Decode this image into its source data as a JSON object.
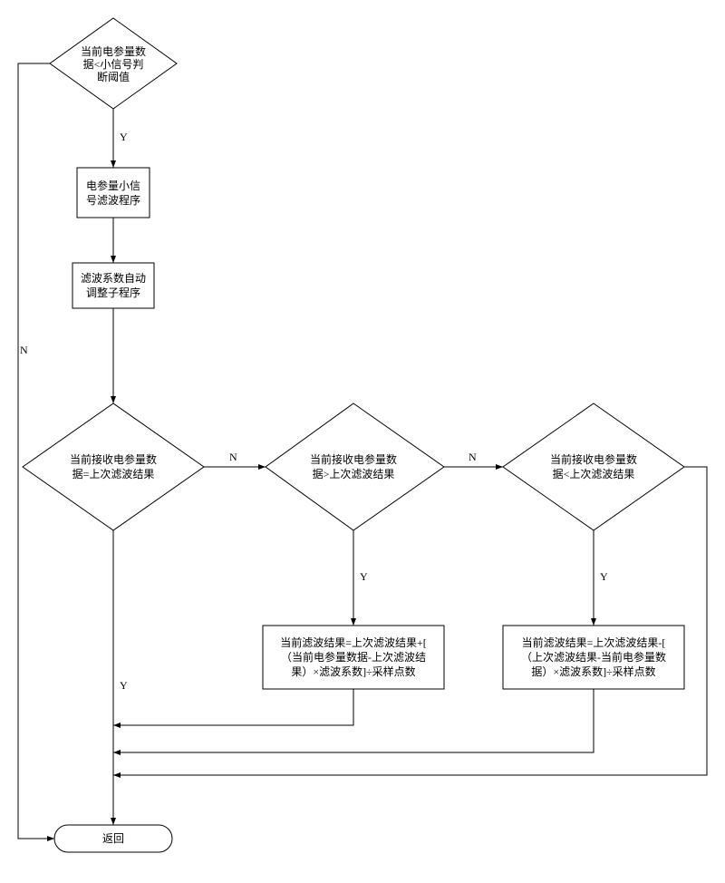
{
  "nodes": {
    "d1": {
      "line1": "当前电参量数",
      "line2": "据<小信号判",
      "line3": "断阈值"
    },
    "p1": {
      "line1": "电参量小信",
      "line2": "号滤波程序"
    },
    "p2": {
      "line1": "滤波系数自动",
      "line2": "调整子程序"
    },
    "d2": {
      "line1": "当前接收电参量数",
      "line2": "据=上次滤波结果"
    },
    "d3": {
      "line1": "当前接收电参量数",
      "line2": "据>上次滤波结果"
    },
    "d4": {
      "line1": "当前接收电参量数",
      "line2": "据<上次滤波结果"
    },
    "p3": {
      "line1": "当前滤波结果=上次滤波结果+[",
      "line2": "（当前电参量数据-上次滤波结",
      "line3": "果）×滤波系数]÷采样点数"
    },
    "p4": {
      "line1": "当前滤波结果=上次滤波结果-[",
      "line2": "（上次滤波结果-当前电参量数",
      "line3": "据）×滤波系数]÷采样点数"
    },
    "end": {
      "label": "返回"
    }
  },
  "edges": {
    "yes": "Y",
    "no": "N"
  }
}
